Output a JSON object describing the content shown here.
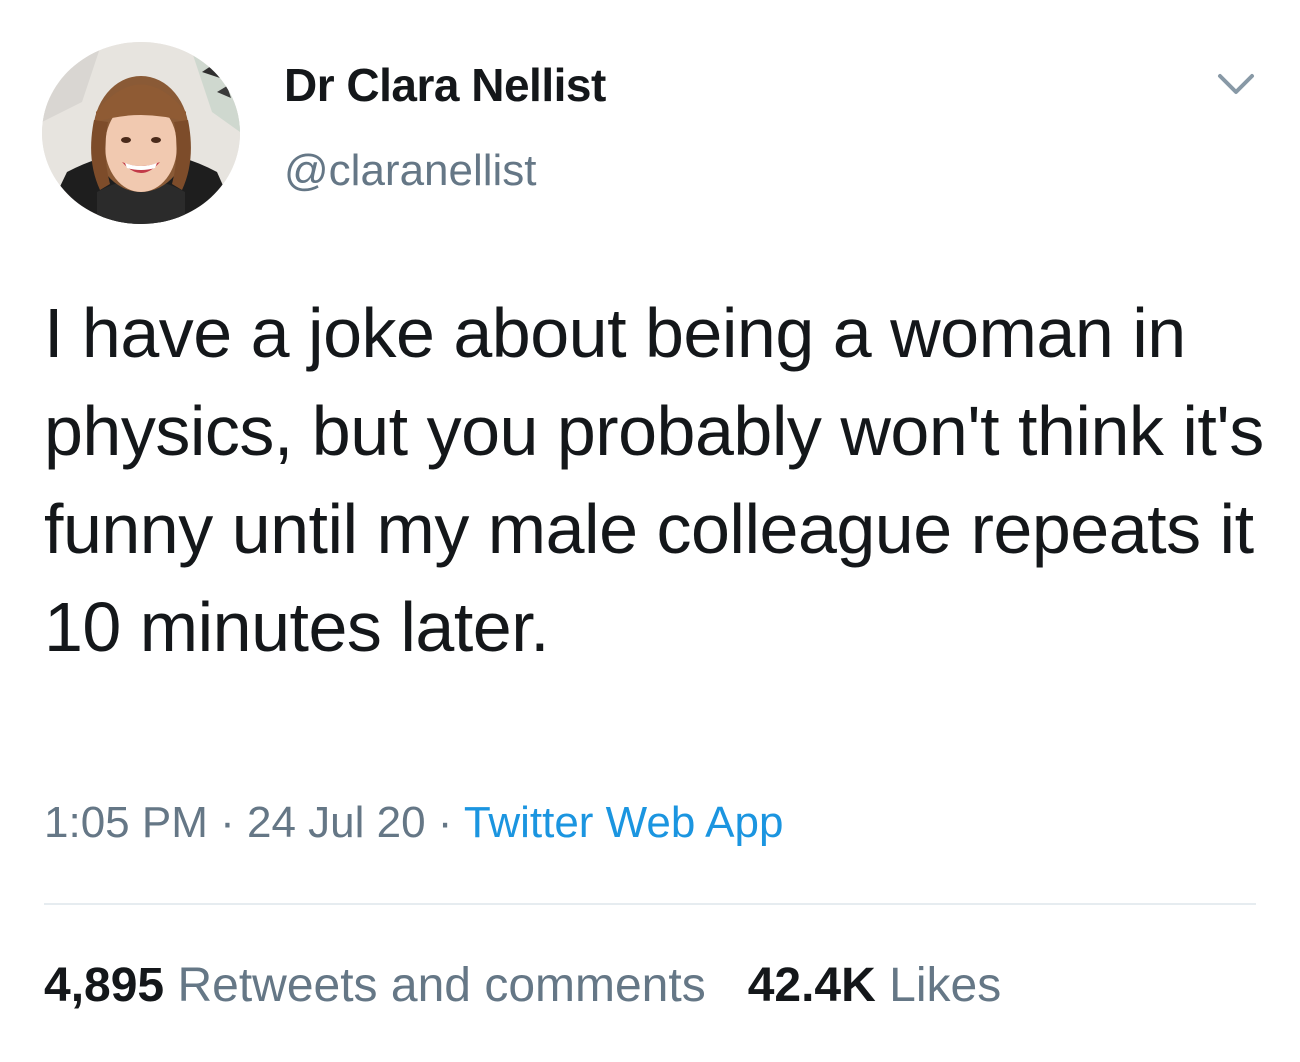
{
  "author": {
    "display_name": "Dr Clara Nellist",
    "handle": "@claranellist"
  },
  "tweet": {
    "text": "I have a joke about being a woman in physics, but you probably won't think it's funny until my male colleague repeats it 10 minutes later.",
    "time": "1:05 PM",
    "date": "24 Jul 20",
    "separator": " · ",
    "source": "Twitter Web App"
  },
  "stats": {
    "retweets_count": "4,895",
    "retweets_label": "Retweets and comments",
    "likes_count": "42.4K",
    "likes_label": "Likes"
  },
  "icons": {
    "menu": "chevron-down-icon",
    "avatar": "avatar"
  },
  "colors": {
    "text_primary": "#14171a",
    "text_secondary": "#657786",
    "link": "#1b95e0",
    "divider": "#e6ecf0"
  }
}
